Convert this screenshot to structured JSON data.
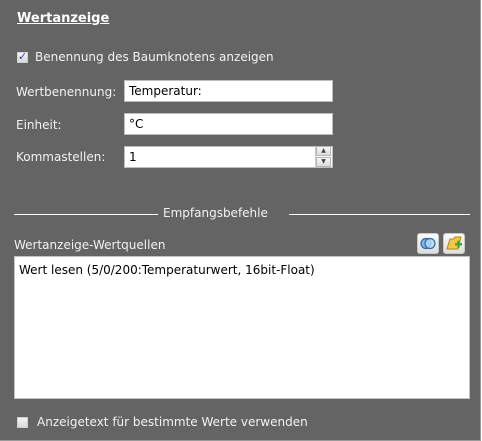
{
  "section": {
    "title": "Wertanzeige"
  },
  "show_node_name": {
    "label": "Benennung des Baumknotens anzeigen",
    "checked": true
  },
  "fields": {
    "value_name": {
      "label": "Wertbenennung:",
      "value": "Temperatur:"
    },
    "unit": {
      "label": "Einheit:",
      "value": "°C"
    },
    "decimals": {
      "label": "Kommastellen:",
      "value": "1"
    }
  },
  "divider": {
    "label": "Empfangsbefehle"
  },
  "sources": {
    "label": "Wertanzeige-Wertquellen",
    "items": [
      "Wert lesen (5/0/200:Temperaturwert, 16bit-Float)"
    ],
    "icons": {
      "view": "view-icon",
      "add": "add-folder-icon"
    }
  },
  "custom_text": {
    "label": "Anzeigetext für bestimmte Werte verwenden",
    "checked": false
  },
  "colors": {
    "panel_bg": "#646464",
    "text": "#ffffff",
    "input_bg": "#ffffff"
  }
}
